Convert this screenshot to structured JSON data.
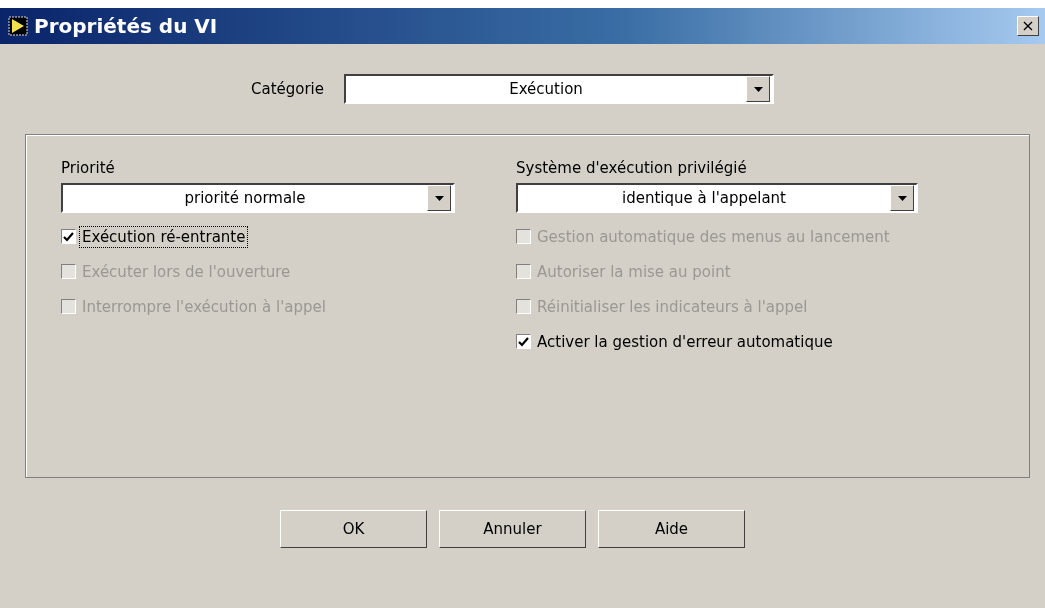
{
  "window": {
    "title": "Propriétés du VI",
    "close": "×"
  },
  "category": {
    "label": "Catégorie",
    "value": "Exécution"
  },
  "columns": [
    {
      "label": "Priorité",
      "dropdown": "priorité normale",
      "options": [
        {
          "label": "Exécution ré-entrante",
          "checked": true,
          "disabled": false,
          "focused": true
        },
        {
          "label": "Exécuter lors de l'ouverture",
          "checked": false,
          "disabled": true,
          "focused": false
        },
        {
          "label": "Interrompre l'exécution à l'appel",
          "checked": false,
          "disabled": true,
          "focused": false
        }
      ]
    },
    {
      "label": "Système d'exécution privilégié",
      "dropdown": "identique à l'appelant",
      "options": [
        {
          "label": "Gestion automatique des menus au lancement",
          "checked": false,
          "disabled": true,
          "focused": false
        },
        {
          "label": "Autoriser la mise au point",
          "checked": false,
          "disabled": true,
          "focused": false
        },
        {
          "label": "Réinitialiser les indicateurs à l'appel",
          "checked": false,
          "disabled": true,
          "focused": false
        },
        {
          "label": "Activer la gestion d'erreur automatique",
          "checked": true,
          "disabled": false,
          "focused": false
        }
      ]
    }
  ],
  "buttons": [
    "OK",
    "Annuler",
    "Aide"
  ]
}
